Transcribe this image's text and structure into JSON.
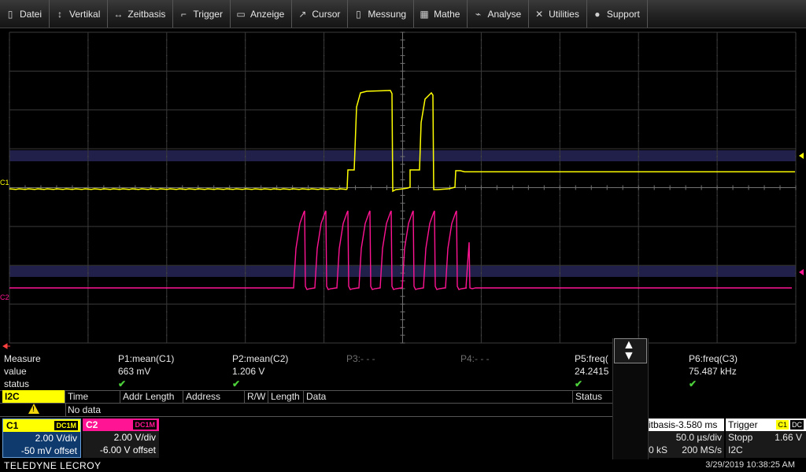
{
  "menu": [
    {
      "icon": "document-icon",
      "glyph": "▯",
      "label": "Datei"
    },
    {
      "icon": "vertical-arrows-icon",
      "glyph": "↕",
      "label": "Vertikal"
    },
    {
      "icon": "horizontal-arrows-icon",
      "glyph": "↔",
      "label": "Zeitbasis"
    },
    {
      "icon": "trigger-edge-icon",
      "glyph": "⌐",
      "label": "Trigger"
    },
    {
      "icon": "display-icon",
      "glyph": "▭",
      "label": "Anzeige"
    },
    {
      "icon": "cursor-icon",
      "glyph": "↗",
      "label": "Cursor"
    },
    {
      "icon": "measure-icon",
      "glyph": "▯",
      "label": "Messung"
    },
    {
      "icon": "calculator-icon",
      "glyph": "▦",
      "label": "Mathe"
    },
    {
      "icon": "analysis-chart-icon",
      "glyph": "⌁",
      "label": "Analyse"
    },
    {
      "icon": "tools-icon",
      "glyph": "✕",
      "label": "Utilities"
    },
    {
      "icon": "info-icon",
      "glyph": "●",
      "label": "Support"
    }
  ],
  "traces": {
    "c1_label": "C1",
    "c2_label": "C2",
    "c1_color": "#ffff00",
    "c2_color": "#ff1493"
  },
  "measure": {
    "labels": {
      "measure": "Measure",
      "value": "value",
      "status": "status"
    },
    "params": [
      {
        "name": "P1:mean(C1)",
        "value": "663 mV",
        "ok": true,
        "active": true
      },
      {
        "name": "P2:mean(C2)",
        "value": "1.206 V",
        "ok": true,
        "active": true
      },
      {
        "name": "P3:- - -",
        "value": "",
        "ok": false,
        "active": false
      },
      {
        "name": "P4:- - -",
        "value": "",
        "ok": false,
        "active": false
      },
      {
        "name": "P5:freq(",
        "value": "24.2415",
        "ok": true,
        "active": true
      },
      {
        "name": "P6:freq(C3)",
        "value": "75.487 kHz",
        "ok": true,
        "active": true
      }
    ],
    "check_glyph": "✔"
  },
  "decode": {
    "tag": "I2C",
    "columns": [
      "Time",
      "Addr Length",
      "Address",
      "R/W",
      "Length",
      "Data",
      "Status"
    ],
    "row_text": "No data",
    "warn_glyph": "!"
  },
  "channels": [
    {
      "name": "C1",
      "coupling": "DC1M",
      "vdiv": "2.00 V/div",
      "offset": "-50 mV offset",
      "color": "#ffff00"
    },
    {
      "name": "C2",
      "coupling": "DC1M",
      "vdiv": "2.00 V/div",
      "offset": "-6.00 V offset",
      "color": "#ff1493"
    }
  ],
  "timebase": {
    "title": "itbasis-3.580 ms",
    "tdiv": "50.0 µs/div",
    "samples": "0 kS",
    "rate": "200 MS/s"
  },
  "trigger": {
    "title": "Trigger",
    "channel": "C1",
    "coupling": "DC",
    "mode": "Stopp",
    "level": "1.66 V",
    "type": "I2C"
  },
  "footer": {
    "brand": "TELEDYNE LECROY",
    "datetime": "3/29/2019 10:38:25 AM"
  },
  "scroll_glyph_up": "▲",
  "scroll_glyph_down": "▼"
}
